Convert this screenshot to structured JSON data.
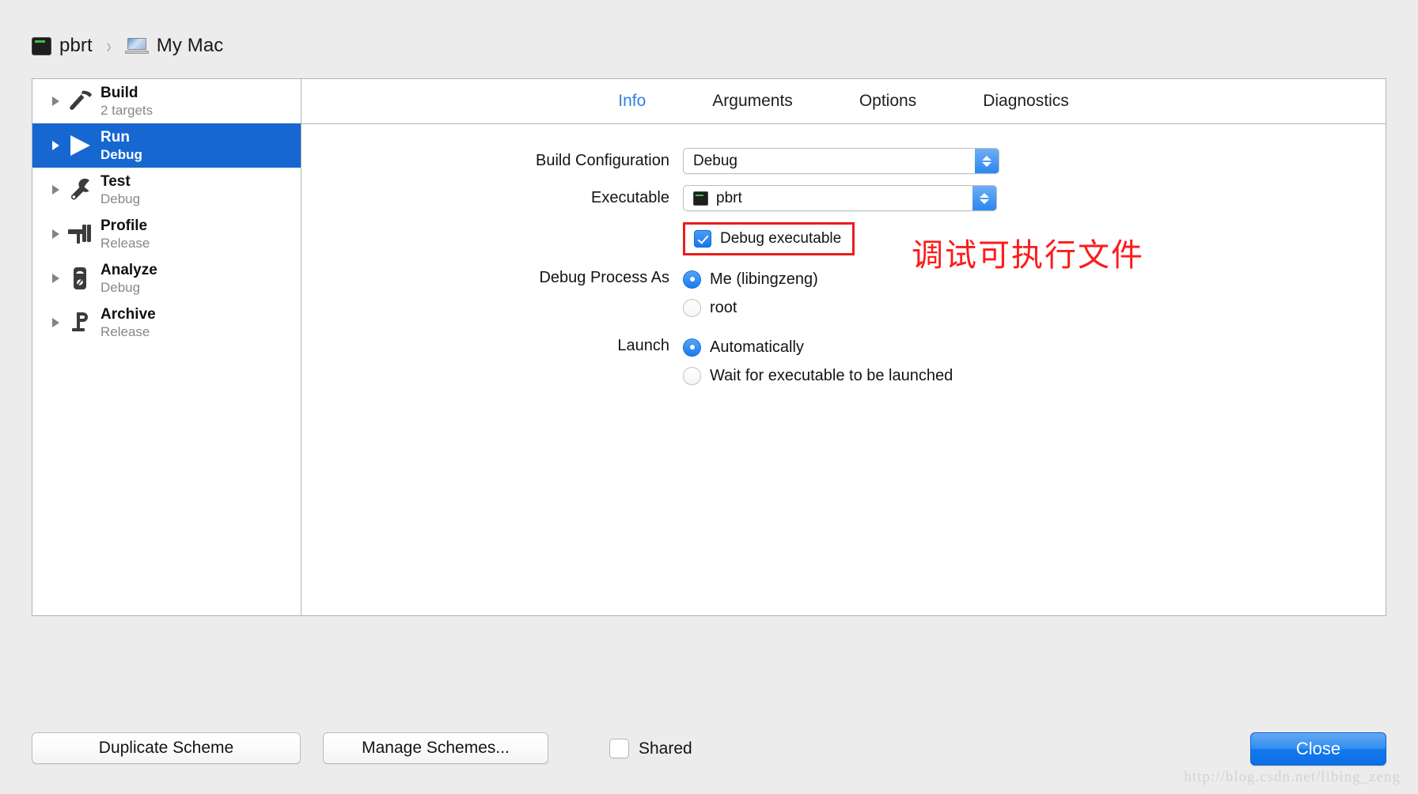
{
  "breadcrumb": {
    "project_icon": "terminal-icon",
    "project": "pbrt",
    "separator": "›",
    "destination_icon": "mac-laptop-icon",
    "destination": "My Mac"
  },
  "sidebar": {
    "items": [
      {
        "title": "Build",
        "subtitle": "2 targets",
        "icon": "hammer-icon",
        "selected": false
      },
      {
        "title": "Run",
        "subtitle": "Debug",
        "icon": "play-icon",
        "selected": true
      },
      {
        "title": "Test",
        "subtitle": "Debug",
        "icon": "wrench-icon",
        "selected": false
      },
      {
        "title": "Profile",
        "subtitle": "Release",
        "icon": "caliper-icon",
        "selected": false
      },
      {
        "title": "Analyze",
        "subtitle": "Debug",
        "icon": "microscope-icon",
        "selected": false
      },
      {
        "title": "Archive",
        "subtitle": "Release",
        "icon": "clamp-icon",
        "selected": false
      }
    ],
    "disclosure_icon": "disclosure-triangle-icon"
  },
  "tabs": [
    {
      "label": "Info",
      "active": true
    },
    {
      "label": "Arguments",
      "active": false
    },
    {
      "label": "Options",
      "active": false
    },
    {
      "label": "Diagnostics",
      "active": false
    }
  ],
  "form": {
    "build_configuration": {
      "label": "Build Configuration",
      "value": "Debug",
      "stepper_icon": "stepper-updown-icon"
    },
    "executable": {
      "label": "Executable",
      "value": "pbrt",
      "icon": "terminal-icon",
      "stepper_icon": "stepper-updown-icon"
    },
    "debug_executable": {
      "label": "Debug executable",
      "checked": true
    },
    "debug_process_as": {
      "label": "Debug Process As",
      "options": [
        {
          "label": "Me (libingzeng)",
          "selected": true
        },
        {
          "label": "root",
          "selected": false
        }
      ]
    },
    "launch": {
      "label": "Launch",
      "options": [
        {
          "label": "Automatically",
          "selected": true
        },
        {
          "label": "Wait for executable to be launched",
          "selected": false
        }
      ]
    }
  },
  "annotation": {
    "text": "调试可执行文件",
    "color": "#fc1b1b",
    "highlight_target": "Debug executable"
  },
  "footer": {
    "duplicate_scheme": "Duplicate Scheme",
    "manage_schemes": "Manage Schemes...",
    "shared": {
      "label": "Shared",
      "checked": false
    },
    "close": "Close"
  },
  "watermark": "http://blog.csdn.net/libing_zeng",
  "colors": {
    "accent": "#1667d0",
    "tab_active": "#2f7fe0",
    "annotation_red": "#fc1b1b",
    "window_bg": "#ececec",
    "panel_bg": "#ffffff"
  }
}
